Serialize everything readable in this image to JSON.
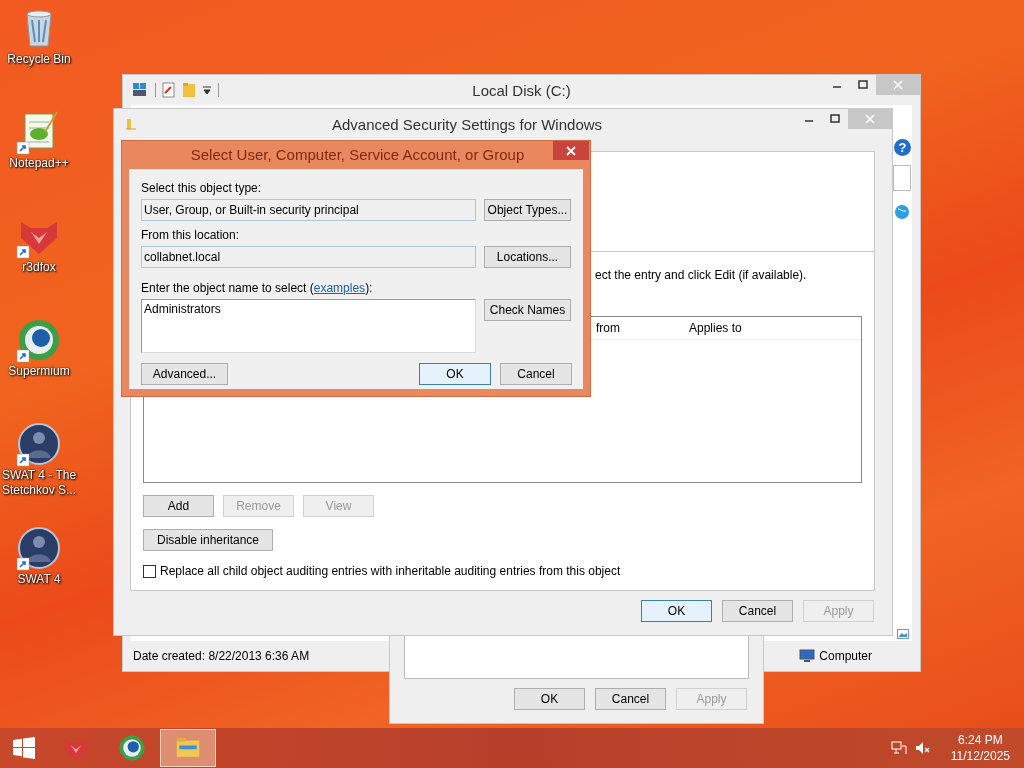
{
  "desktop_icons": [
    {
      "label": "Recycle Bin",
      "kind": "recycle",
      "shortcut": false
    },
    {
      "label": "Notepad++",
      "kind": "notepad",
      "shortcut": true
    },
    {
      "label": "r3dfox",
      "kind": "r3dfox",
      "shortcut": true
    },
    {
      "label": "Supermium",
      "kind": "supermium",
      "shortcut": true
    },
    {
      "label": "SWAT 4 - The Stetchkov S...",
      "kind": "swat",
      "shortcut": true
    },
    {
      "label": "SWAT 4",
      "kind": "swat",
      "shortcut": true
    }
  ],
  "explorer_window": {
    "title": "Local Disk (C:)",
    "help_button": "?",
    "status_text": "Date created: 8/22/2013 6:36 AM",
    "location_label": "Computer"
  },
  "properties_dialog": {
    "buttons": [
      {
        "label": "OK",
        "disabled": false
      },
      {
        "label": "Cancel",
        "disabled": false
      },
      {
        "label": "Apply",
        "disabled": true
      }
    ]
  },
  "security_window": {
    "title": "Advanced Security Settings for Windows",
    "instruction": "ect the entry and click Edit (if available).",
    "columns": [
      "from",
      "Applies to"
    ],
    "entry_buttons": [
      {
        "label": "Add",
        "disabled": false
      },
      {
        "label": "Remove",
        "disabled": true
      },
      {
        "label": "View",
        "disabled": true
      }
    ],
    "inheritance_button": "Disable inheritance",
    "replace_checkbox": {
      "label": "Replace all child object auditing entries with inheritable auditing entries from this object",
      "checked": false
    },
    "buttons": [
      {
        "label": "OK",
        "disabled": false,
        "default": true
      },
      {
        "label": "Cancel",
        "disabled": false,
        "default": false
      },
      {
        "label": "Apply",
        "disabled": true,
        "default": false
      }
    ]
  },
  "select_dialog": {
    "title": "Select User, Computer, Service Account, or Group",
    "object_type_label": "Select this object type:",
    "object_type_value": "User, Group, or Built-in security principal",
    "object_types_button": "Object Types...",
    "location_label": "From this location:",
    "location_value": "collabnet.local",
    "locations_button": "Locations...",
    "name_prompt": {
      "before": "Enter the object name to select (",
      "link": "examples",
      "after": "):"
    },
    "names_value": "Administrators",
    "check_names_button": "Check Names",
    "advanced_button": "Advanced...",
    "buttons": [
      {
        "label": "OK",
        "default": true
      },
      {
        "label": "Cancel",
        "default": false
      }
    ]
  },
  "taskbar": {
    "apps": [
      {
        "kind": "r3dfox",
        "active": false
      },
      {
        "kind": "supermium",
        "active": false
      },
      {
        "kind": "explorer",
        "active": true
      }
    ],
    "time": "6:24 PM",
    "date": "11/12/2025"
  }
}
